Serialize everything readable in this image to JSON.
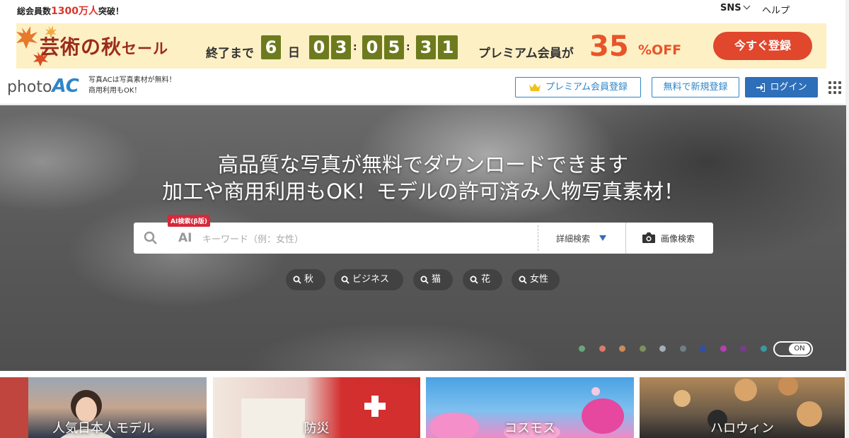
{
  "topbar": {
    "members_prefix": "総会員数",
    "members_highlight": "1300万人",
    "members_suffix": "突破！",
    "sns_label": "SNS",
    "help_label": "ヘルプ"
  },
  "sale_banner": {
    "title_main": "芸術の秋",
    "title_sub": "セール",
    "until_label": "終了まで",
    "days_value": "6",
    "days_unit": "日",
    "hours": [
      "0",
      "3"
    ],
    "minutes": [
      "0",
      "5"
    ],
    "seconds": [
      "3",
      "1"
    ],
    "premium_label": "プレミアム会員が",
    "discount_number": "35",
    "discount_unit": "%OFF",
    "cta_label": "今すぐ登録"
  },
  "header": {
    "logo_text": "photo",
    "logo_accent": "AC",
    "tagline_line1": "写真ACは写真素材が無料！",
    "tagline_line2": "商用利用もOK！",
    "premium_button": "プレミアム会員登録",
    "free_signup_button": "無料で新規登録",
    "login_button": "ログイン"
  },
  "hero": {
    "headline_line1": "高品質な写真が無料でダウンロードできます",
    "headline_line2": "加工や商用利用もOK！モデルの許可済み人物写真素材！",
    "search": {
      "ai_badge": "AI検索(β版)",
      "ai_label": "AI",
      "placeholder": "キーワード（例：女性）",
      "advanced_label": "詳細検索",
      "image_search_label": "画像検索"
    },
    "chips": [
      "秋",
      "ビジネス",
      "猫",
      "花",
      "女性"
    ],
    "color_dots": [
      "#6aa57a",
      "#d97a6a",
      "#c98c5a",
      "#7f8f5f",
      "#a4b0b8",
      "#6f7f86",
      "#2f4fa8",
      "#b43fb0",
      "#7a3a90",
      "#3a9aa0"
    ],
    "toggle_label": "ON"
  },
  "categories": [
    {
      "label": "人気日本人モデル"
    },
    {
      "label": "防災"
    },
    {
      "label": "コスモス"
    },
    {
      "label": "ハロウィン"
    }
  ]
}
